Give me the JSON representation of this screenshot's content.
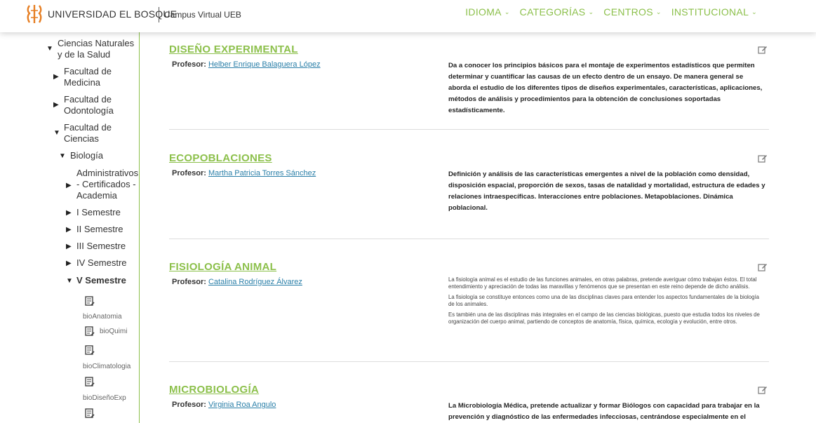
{
  "header": {
    "brand": "UNIVERSIDAD EL BOSQUE",
    "subtitle": "Campus Virtual UEB",
    "nav": [
      {
        "label": "IDIOMA"
      },
      {
        "label": "CATEGORÍAS"
      },
      {
        "label": "CENTROS"
      },
      {
        "label": "INSTITUCIONAL"
      }
    ],
    "accent_color": "#8cc04b"
  },
  "sidebar": {
    "items": [
      {
        "label": "Ciencias Naturales y de la Salud",
        "state": "expanded"
      },
      {
        "label": "Facultad de Medicina",
        "state": "collapsed"
      },
      {
        "label": "Facultad de Odontología",
        "state": "collapsed"
      },
      {
        "label": "Facultad de Ciencias",
        "state": "expanded"
      },
      {
        "label": "Biología",
        "state": "expanded"
      },
      {
        "label": "Administrativos - Certificados - Academia",
        "state": "collapsed"
      },
      {
        "label": "I Semestre",
        "state": "collapsed"
      },
      {
        "label": "II Semestre",
        "state": "collapsed"
      },
      {
        "label": "III Semestre",
        "state": "collapsed"
      },
      {
        "label": "IV Semestre",
        "state": "collapsed"
      },
      {
        "label": "V Semestre",
        "state": "expanded"
      }
    ],
    "courses": [
      {
        "label": "bioAnatomia",
        "icon": "course-icon"
      },
      {
        "label": "bioQuimi",
        "icon": "course-icon"
      },
      {
        "label": "bioClimatologia",
        "icon": "course-icon"
      },
      {
        "label": "bioDiseñoExp",
        "icon": "course-icon"
      },
      {
        "label": "",
        "icon": "course-icon"
      }
    ]
  },
  "courses": [
    {
      "title": "DISEÑO EXPERIMENTAL",
      "professor_label": "Profesor:",
      "professor": "Helber Enrique Balaguera López",
      "description": "Da a conocer los principios básicos para el montaje de experimentos estadísticos que permiten determinar y cuantificar las causas de un efecto dentro de un ensayo. De manera general se aborda el estudio de los diferentes tipos de diseños experimentales, características, aplicaciones, métodos de análisis y procedimientos para la obtención de conclusiones soportadas estadísticamente."
    },
    {
      "title": "ECOPOBLACIONES",
      "professor_label": "Profesor:",
      "professor": "Martha Patricia Torres Sánchez",
      "description": "Definición y análisis de las características emergentes a nivel de la población como densidad, disposición espacial, proporción de sexos, tasas de natalidad y mortalidad, estructura de edades y relaciones intraespecíficas. Interacciones entre poblaciones. Metapoblaciones. Dinámica poblacional."
    },
    {
      "title": "FISIOLOGÍA ANIMAL",
      "professor_label": "Profesor:",
      "professor": "Catalina Rodríguez Álvarez",
      "paragraphs": [
        "La fisiología animal es el estudio de las funciones animales, en otras palabras, pretende averiguar cómo trabajan éstos. El total entendimiento y apreciación de todas las maravillas y fenómenos que se presentan en este reino depende de dicho análisis.",
        "La fisiología se constituye entonces como una de las disciplinas claves para entender los aspectos fundamentales de la biología de los animales.",
        "Es también una de las disciplinas más integrales en el campo de las ciencias biológicas, puesto que estudia todos los niveles de organización del cuerpo animal, partiendo de conceptos de anatomía, física, química, ecología y evolución, entre otros."
      ]
    },
    {
      "title": "MICROBIOLOGÍA",
      "professor_label": "Profesor:",
      "professor": "Virginia Roa Angulo",
      "description": "La Microbiología Médica, pretende actualizar y formar Biólogos con capacidad para trabajar  en la prevención y diagnóstico de las enfermedades infecciosas, centrándose especialmente en el"
    }
  ]
}
